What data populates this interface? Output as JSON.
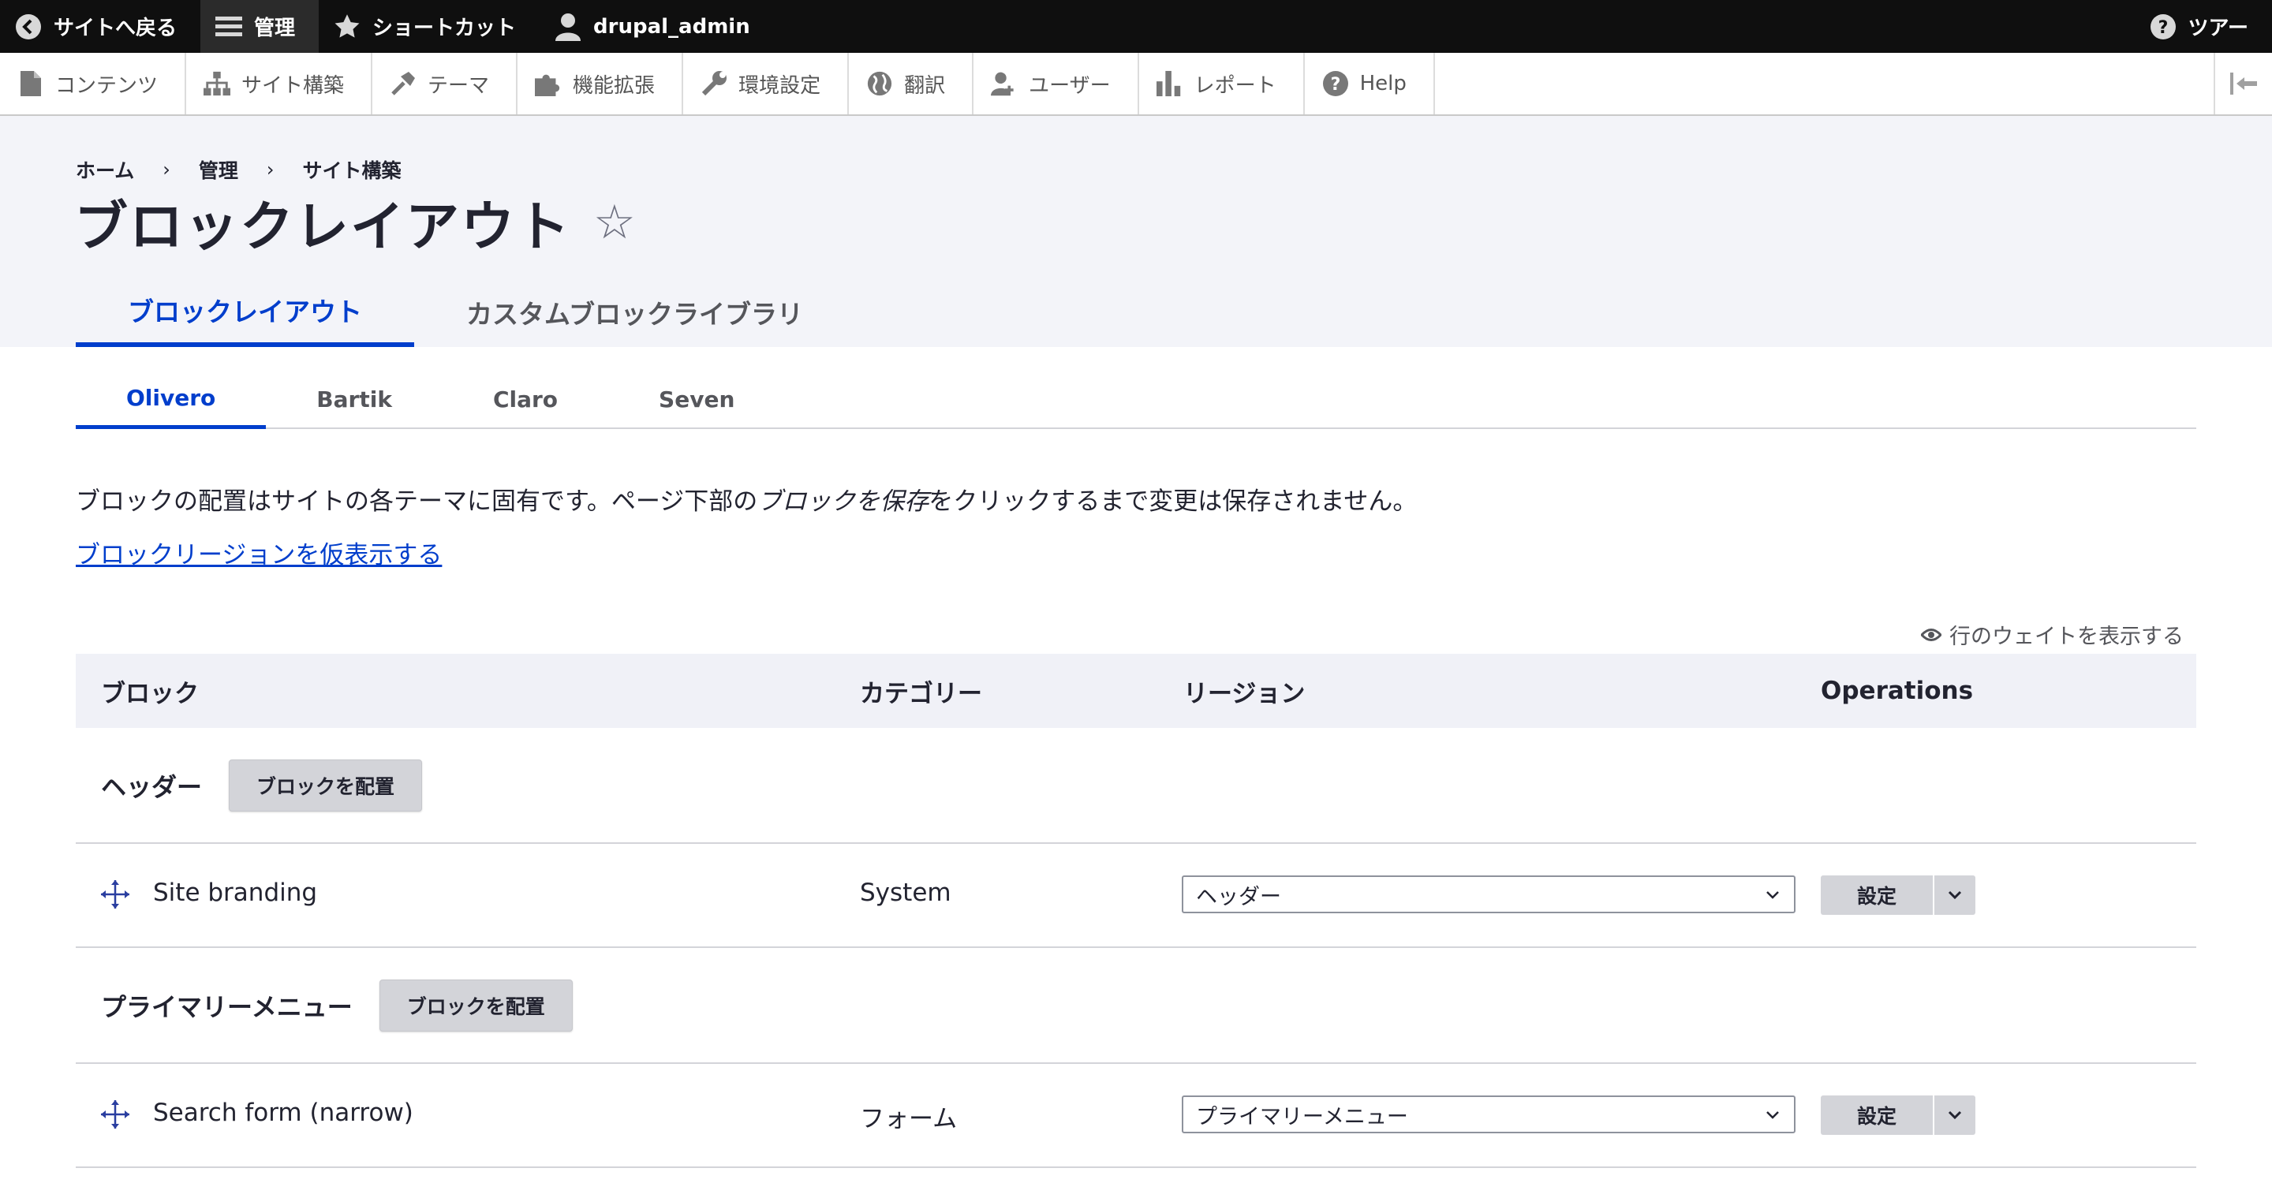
{
  "toolbar": {
    "back": "サイトへ戻る",
    "manage": "管理",
    "shortcuts": "ショートカット",
    "user": "drupal_admin",
    "tour": "ツアー"
  },
  "tray": {
    "items": [
      {
        "label": "コンテンツ"
      },
      {
        "label": "サイト構築"
      },
      {
        "label": "テーマ"
      },
      {
        "label": "機能拡張"
      },
      {
        "label": "環境設定"
      },
      {
        "label": "翻訳"
      },
      {
        "label": "ユーザー"
      },
      {
        "label": "レポート"
      },
      {
        "label": "Help"
      }
    ]
  },
  "breadcrumb": [
    "ホーム",
    "管理",
    "サイト構築"
  ],
  "breadcrumb_sep": "›",
  "page_title": "ブロックレイアウト",
  "star": "☆",
  "primary_tabs": [
    "ブロックレイアウト",
    "カスタムブロックライブラリ"
  ],
  "secondary_tabs": [
    "Olivero",
    "Bartik",
    "Claro",
    "Seven"
  ],
  "description": {
    "before": "ブロックの配置はサイトの各テーマに固有です。ページ下部の",
    "em": "ブロックを保存",
    "after": "をクリックするまで変更は保存されません。"
  },
  "demo_link": "ブロックリージョンを仮表示する",
  "show_weights": "行のウェイトを表示する",
  "table": {
    "headers": [
      "ブロック",
      "カテゴリー",
      "リージョン",
      "Operations"
    ],
    "place_button": "ブロックを配置",
    "configure": "設定",
    "regions": [
      {
        "name": "ヘッダー",
        "blocks": [
          {
            "name": "Site branding",
            "category": "System",
            "region": "ヘッダー"
          }
        ]
      },
      {
        "name": "プライマリーメニュー",
        "blocks": [
          {
            "name": "Search form (narrow)",
            "category": "フォーム",
            "region": "プライマリーメニュー"
          }
        ]
      }
    ]
  }
}
